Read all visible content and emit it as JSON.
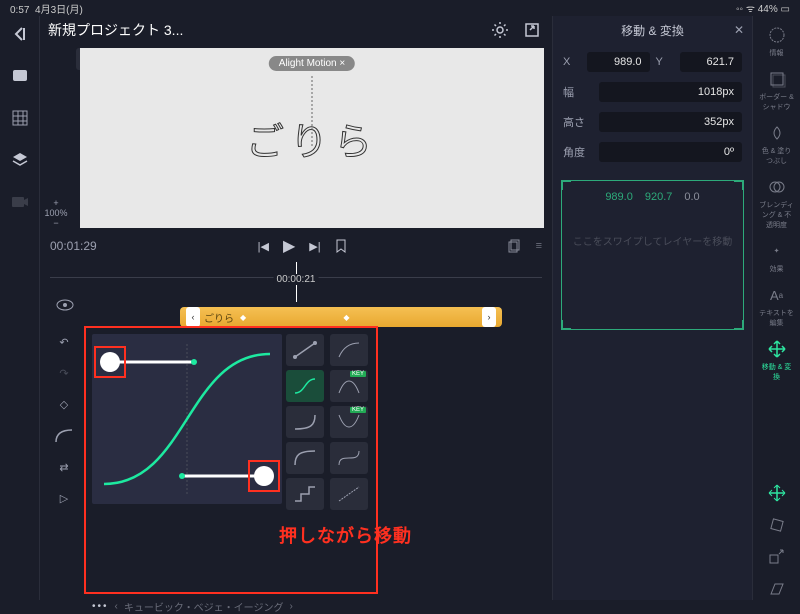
{
  "status": {
    "time": "0:57",
    "date": "4月3日(月)",
    "wifi": "wifi",
    "battery": "44%"
  },
  "header": {
    "title": "新規プロジェクト 3..."
  },
  "canvas": {
    "watermark": "Alight Motion ×",
    "text": "ごりら"
  },
  "zoom": {
    "plus": "+",
    "value": "100%",
    "minus": "−"
  },
  "transport": {
    "current_time": "00:01:29",
    "ruler_time": "00:00:21"
  },
  "clip": {
    "label": "ごりら"
  },
  "curve": {
    "footer_label": "キュービック・ベジェ・イージング"
  },
  "annotation": "押しながら移動",
  "panel": {
    "title": "移動 & 変換",
    "x_label": "X",
    "x_val": "989.0",
    "y_label": "Y",
    "y_val": "621.7",
    "w_label": "幅",
    "w_val": "1018px",
    "h_label": "高さ",
    "h_val": "352px",
    "a_label": "角度",
    "a_val": "0º"
  },
  "pad": {
    "v1": "989.0",
    "v2": "920.7",
    "v3": "0.0",
    "hint": "ここをスワイプしてレイヤーを移動"
  },
  "far_right": {
    "info": "情報",
    "border": "ボーダー & シャドウ",
    "fill": "色 & 塗りつぶし",
    "blend": "ブレンディング & 不透明度",
    "fx": "効果",
    "text": "テキストを編集",
    "transform": "移動 & 変換"
  }
}
